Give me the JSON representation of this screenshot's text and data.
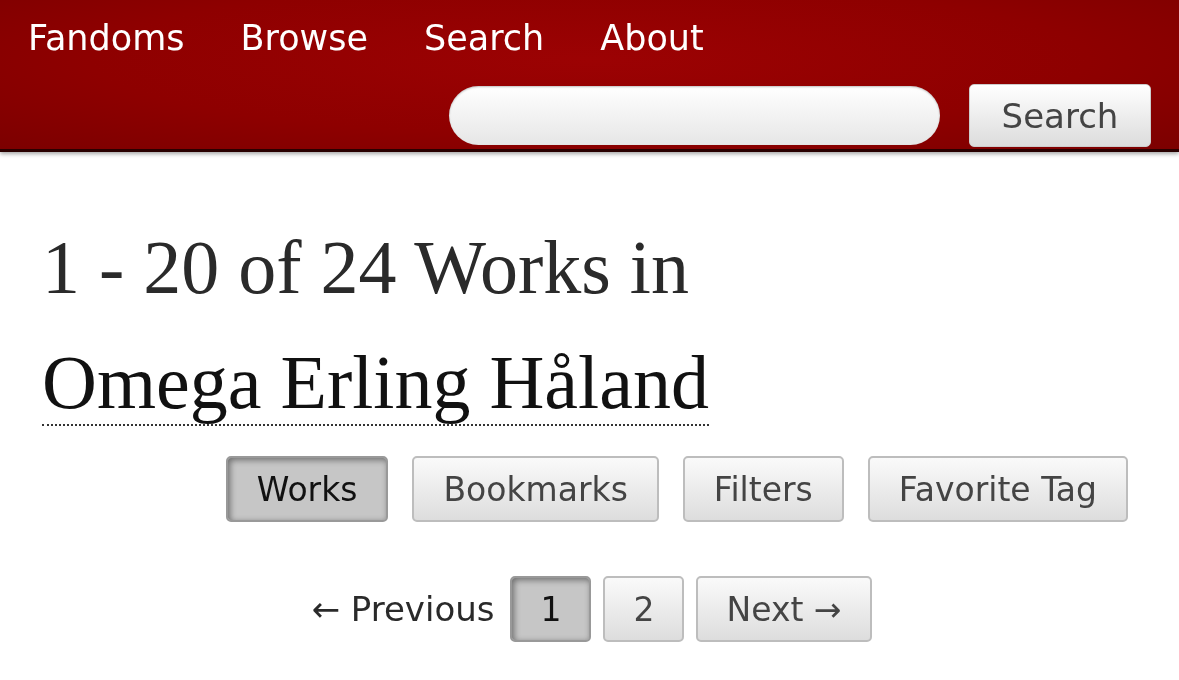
{
  "nav": {
    "links": [
      "Fandoms",
      "Browse",
      "Search",
      "About"
    ],
    "search_button": "Search"
  },
  "heading": {
    "text": "1 - 20 of 24 Works in",
    "tag": "Omega Erling Håland"
  },
  "tabs": [
    {
      "label": "Works",
      "selected": true
    },
    {
      "label": "Bookmarks",
      "selected": false
    },
    {
      "label": "Filters",
      "selected": false
    },
    {
      "label": "Favorite Tag",
      "selected": false
    }
  ],
  "pagination": {
    "previous": {
      "label": "← Previous",
      "disabled": true
    },
    "pages": [
      {
        "label": "1",
        "selected": true
      },
      {
        "label": "2",
        "selected": false
      }
    ],
    "next": {
      "label": "Next →",
      "disabled": false
    }
  }
}
